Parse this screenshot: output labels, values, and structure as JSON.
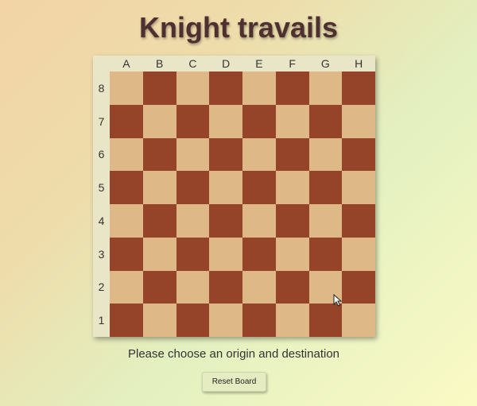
{
  "page": {
    "title": "Knight travails"
  },
  "board": {
    "files": [
      "A",
      "B",
      "C",
      "D",
      "E",
      "F",
      "G",
      "H"
    ],
    "ranks": [
      "8",
      "7",
      "6",
      "5",
      "4",
      "3",
      "2",
      "1"
    ],
    "colors": {
      "light": "#deb887",
      "dark": "#954329"
    }
  },
  "status": {
    "message": "Please choose an origin and destination"
  },
  "controls": {
    "reset_label": "Reset Board"
  },
  "icons": {
    "cursor": "mouse-pointer-icon"
  }
}
